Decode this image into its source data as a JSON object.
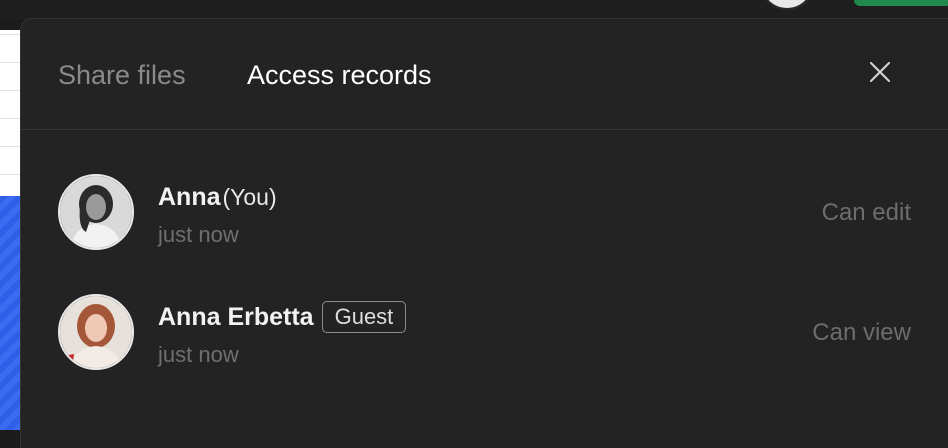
{
  "tabs": [
    {
      "label": "Share files",
      "active": false
    },
    {
      "label": "Access records",
      "active": true
    }
  ],
  "close_icon": "close-icon",
  "records": [
    {
      "name": "Anna",
      "suffix": "(You)",
      "badge": "",
      "time": "just now",
      "permission": "Can edit"
    },
    {
      "name": "Anna Erbetta",
      "suffix": "",
      "badge": "Guest",
      "time": "just now",
      "permission": "Can view"
    }
  ],
  "colors": {
    "modal_background": "#232323",
    "active_tab": "#ffffff",
    "inactive_tab": "#8a8a8a",
    "muted_text": "#6f6f6f"
  }
}
